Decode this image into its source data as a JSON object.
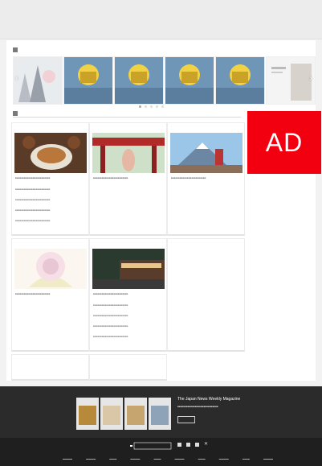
{
  "ad": {
    "label": "AD"
  },
  "colors": {
    "ad_red": "#f30010",
    "footer_dark": "#1f1f1f",
    "subscribe_band": "#2b2b2b"
  },
  "icons": [
    "arrow-prev-icon",
    "arrow-next-icon",
    "facebook-icon",
    "twitter-icon",
    "instagram-icon",
    "x-icon"
  ],
  "subscribe": {
    "title": "The Japan News Weekly Magazine"
  }
}
